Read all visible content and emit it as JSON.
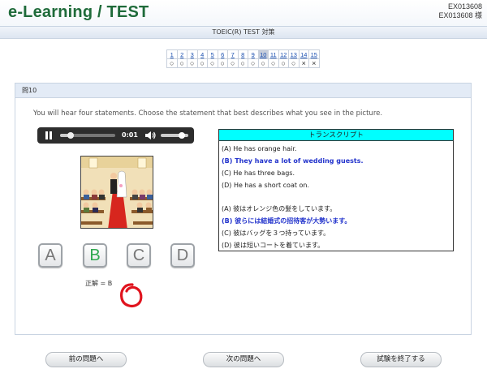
{
  "header": {
    "app_title": "e-Learning / TEST",
    "user_id": "EX013608",
    "user_name": "EX013608 様"
  },
  "subheader": {
    "title": "TOEIC(R) TEST 対策"
  },
  "question_nav": {
    "numbers": [
      "1",
      "2",
      "3",
      "4",
      "5",
      "6",
      "7",
      "8",
      "9",
      "10",
      "11",
      "12",
      "13",
      "14",
      "15"
    ],
    "marks": [
      "○",
      "○",
      "○",
      "○",
      "○",
      "○",
      "○",
      "○",
      "○",
      "○",
      "○",
      "○",
      "○",
      "×",
      "×"
    ],
    "current": 10
  },
  "question": {
    "label": "問10",
    "instruction": "You will hear four statements. Choose the statement that best describes what you see in the picture."
  },
  "player": {
    "time": "0:01",
    "progress": 0.15,
    "volume": 0.85
  },
  "answers": {
    "options": [
      "A",
      "B",
      "C",
      "D"
    ],
    "selected": "B",
    "correct_text": "正解 = B"
  },
  "transcript": {
    "title": "トランスクリプト",
    "en": [
      "(A)  He has orange hair.",
      "(B)  They have a lot of wedding guests.",
      "(C)  He has three bags.",
      "(D)  He has a short coat on."
    ],
    "ja": [
      "(A)  彼はオレンジ色の髪をしています。",
      "(B)  彼らには結婚式の招待客が大勢います。",
      "(C)  彼はバッグを３つ持っています。",
      "(D)  彼は短いコートを着ています。"
    ]
  },
  "footer": {
    "prev_label": "前の問題へ",
    "next_label": "次の問題へ",
    "finish_label": "試験を終了する"
  },
  "colors": {
    "title_green": "#1f6b3a",
    "correct_blue": "#2233cc",
    "transcript_header": "#00ffff",
    "mark_red": "#e0141e"
  },
  "icons": [
    "pause-icon",
    "volume-icon",
    "correct-circle-icon"
  ]
}
